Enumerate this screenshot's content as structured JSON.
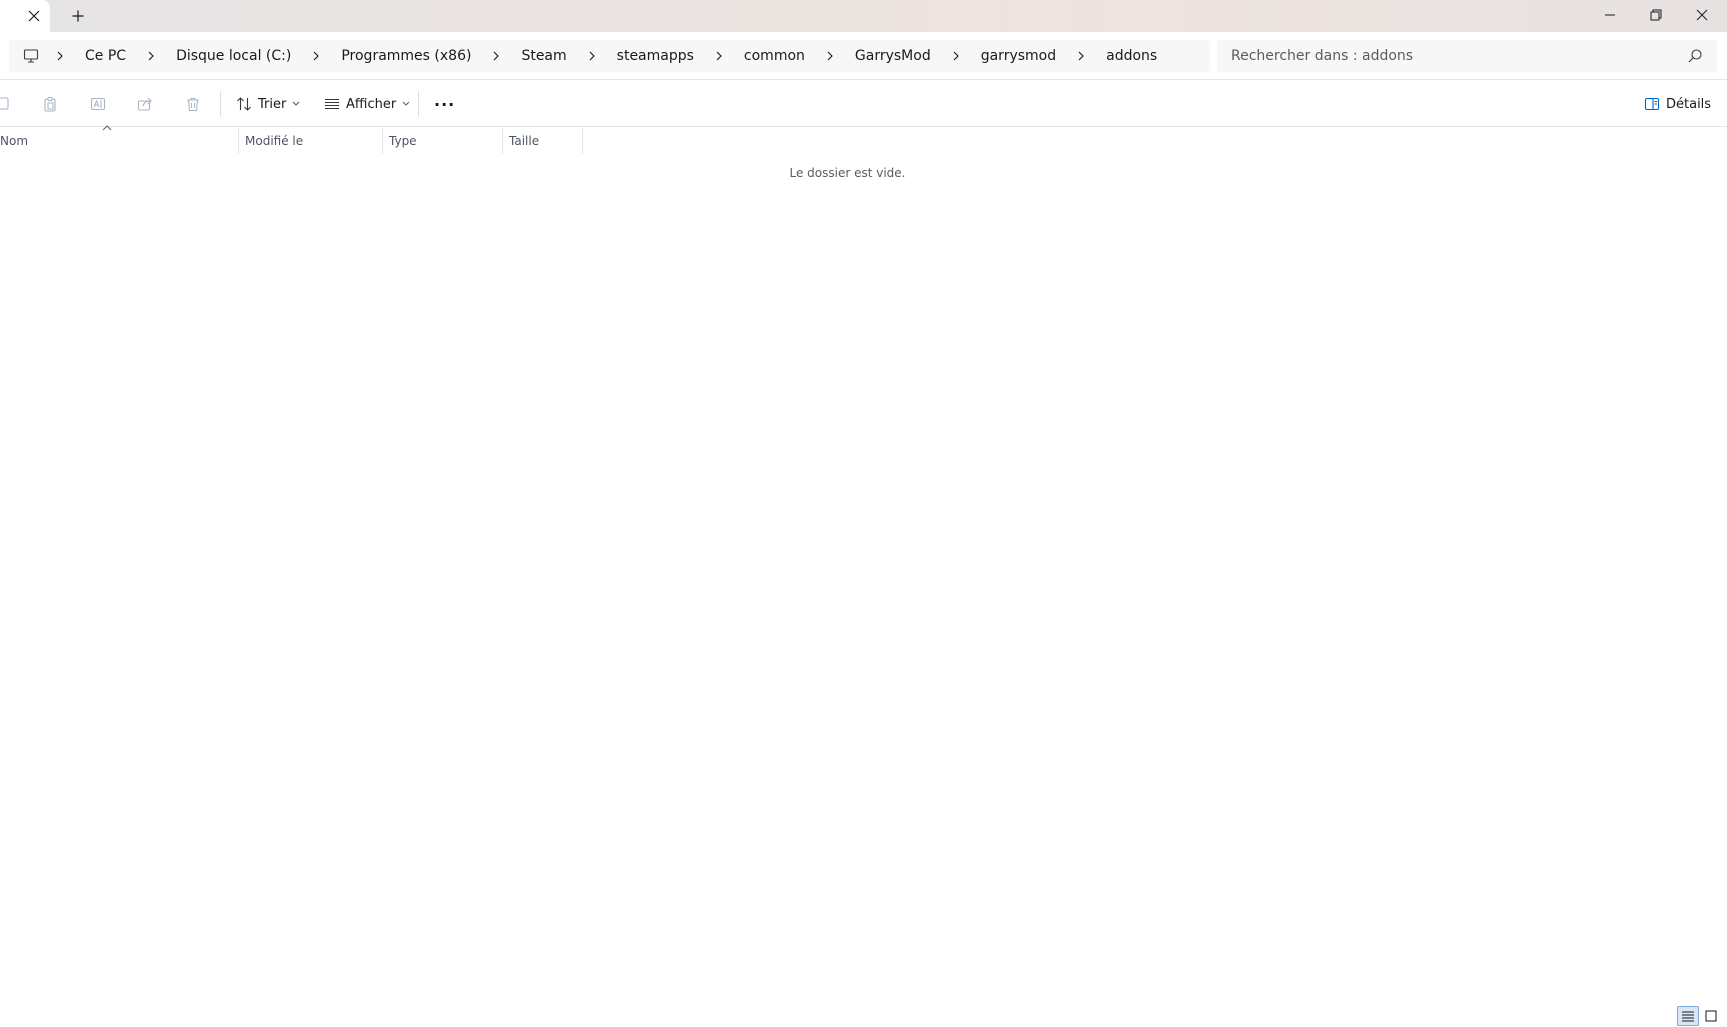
{
  "titlebar": {
    "new_tab_label": "+"
  },
  "address": {
    "breadcrumbs": [
      "Ce PC",
      "Disque local (C:)",
      "Programmes (x86)",
      "Steam",
      "steamapps",
      "common",
      "GarrysMod",
      "garrysmod",
      "addons"
    ]
  },
  "search": {
    "placeholder": "Rechercher dans : addons"
  },
  "toolbar": {
    "sort_label": "Trier",
    "view_label": "Afficher",
    "more_label": "···",
    "details_label": "Détails"
  },
  "columns": {
    "name": "Nom",
    "modified": "Modifié le",
    "type": "Type",
    "size": "Taille"
  },
  "content": {
    "empty_message": "Le dossier est vide."
  },
  "icons": [
    "close-icon",
    "plus-icon",
    "minimize-icon",
    "restore-icon",
    "pc-icon",
    "chevron-right-icon",
    "search-icon",
    "copy-icon",
    "paste-icon",
    "rename-icon",
    "share-icon",
    "delete-icon",
    "sort-icon",
    "view-icon",
    "details-pane-icon",
    "details-view-icon",
    "tiles-view-icon"
  ],
  "colors": {
    "accent": "#0067c0",
    "header_text": "#4c5566"
  }
}
